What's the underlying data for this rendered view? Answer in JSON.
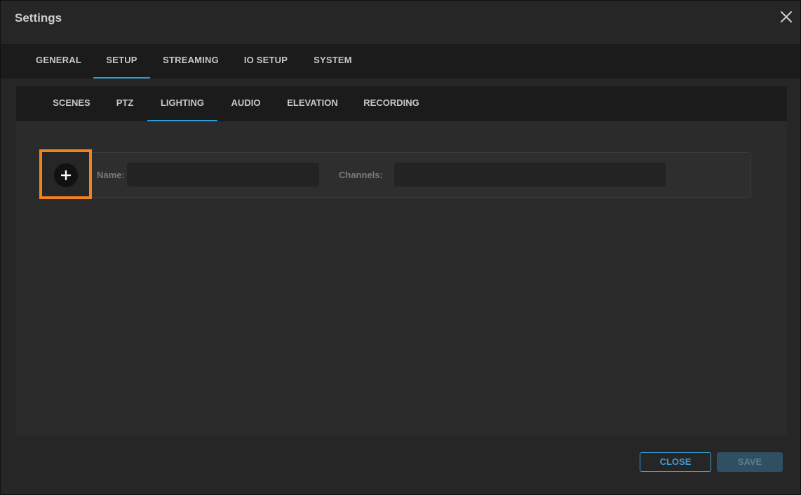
{
  "window": {
    "title": "Settings"
  },
  "main_tabs": [
    {
      "label": "GENERAL",
      "active": false
    },
    {
      "label": "SETUP",
      "active": true
    },
    {
      "label": "STREAMING",
      "active": false
    },
    {
      "label": "IO SETUP",
      "active": false
    },
    {
      "label": "SYSTEM",
      "active": false
    }
  ],
  "sub_tabs": [
    {
      "label": "SCENES",
      "active": false
    },
    {
      "label": "PTZ",
      "active": false
    },
    {
      "label": "LIGHTING",
      "active": true
    },
    {
      "label": "AUDIO",
      "active": false
    },
    {
      "label": "ELEVATION",
      "active": false
    },
    {
      "label": "RECORDING",
      "active": false
    }
  ],
  "lighting_row": {
    "name_label": "Name:",
    "name_value": "",
    "channels_label": "Channels:",
    "channels_value": "",
    "add_icon": "plus-icon"
  },
  "footer": {
    "close_label": "CLOSE",
    "save_label": "SAVE"
  },
  "colors": {
    "accent": "#2e9bd6",
    "highlight": "#f58220"
  }
}
